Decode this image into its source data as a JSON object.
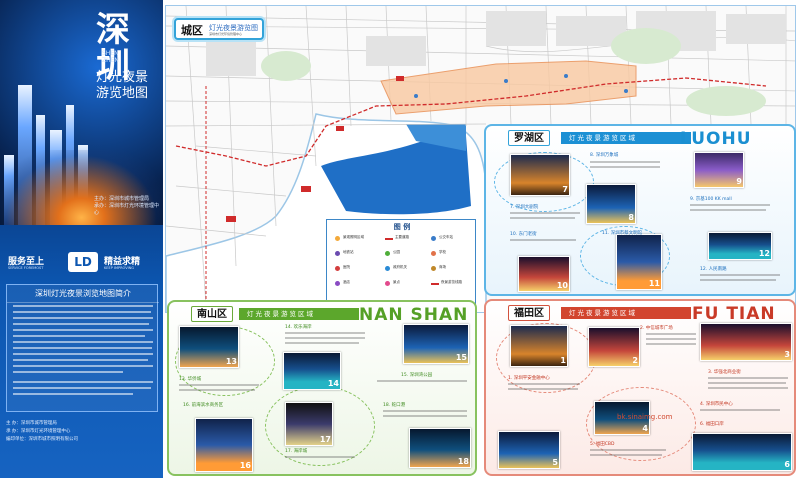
{
  "cover": {
    "title": "深圳",
    "title_en": "SHEN ZHEN",
    "subtitle1": "灯光夜景",
    "subtitle2": "游览地图",
    "org_lines": [
      "主办：深圳市城市管理局",
      "承办：深圳市灯光环境管理中心"
    ],
    "slogan_left": "服务至上",
    "slogan_right": "精益求精",
    "slogan_mid": "LD",
    "slogan_sub_left": "SERVICE FOREMOST",
    "slogan_sub_right": "KEEP IMPROVING",
    "intro_title": "深圳灯光夜景浏览地图简介",
    "credits": [
      "主 办：深圳市城市管理局",
      "承 办：深圳市灯光环境管理中心",
      "编印单位：深圳市城市照明有限公司"
    ]
  },
  "map": {
    "badge_zh": "城区",
    "badge_sub": "灯光夜景游览图",
    "badge_small": "深圳市灯光环境管理中心",
    "legend_title": "图 例",
    "legend_items": [
      {
        "label": "景观照明区域",
        "color": "#f3a93a"
      },
      {
        "label": "主要道路",
        "color": "#d02b2b"
      },
      {
        "label": "公交车站",
        "color": "#3a7cc9"
      },
      {
        "label": "地铁站",
        "color": "#6b4bb0"
      },
      {
        "label": "公园",
        "color": "#4fae3a"
      },
      {
        "label": "学校",
        "color": "#e1724a"
      },
      {
        "label": "医院",
        "color": "#d33d3d"
      },
      {
        "label": "政府机关",
        "color": "#2a8bd6"
      },
      {
        "label": "商场",
        "color": "#c0882a"
      },
      {
        "label": "酒店",
        "color": "#8a4bc3"
      },
      {
        "label": "景点",
        "color": "#e24a8c"
      },
      {
        "label": "夜景游览线路",
        "color": "#d02b2b"
      }
    ]
  },
  "districts": {
    "luohu": {
      "name": "罗湖区",
      "band": "灯光夜景游览区域",
      "en": "LUOHU",
      "captions": [
        "8. 深圳万象城",
        "7. 深圳大剧院",
        "9. 京基100 KK mall",
        "10. 东门老街",
        "11. 深圳市蔡文明馆",
        "12. 人民南路"
      ],
      "numbers": [
        "7",
        "8",
        "9",
        "10",
        "11",
        "12"
      ]
    },
    "nanshan": {
      "name": "南山区",
      "band": "灯光夜景游览区域",
      "en": "NAN SHAN",
      "captions": [
        "14. 欢乐海岸",
        "13. 华侨城",
        "15. 深圳湾公园",
        "16. 前海滨水商务区",
        "17. 海岸城",
        "18. 蛇口港"
      ],
      "numbers": [
        "13",
        "14",
        "15",
        "16",
        "17",
        "18"
      ]
    },
    "futian": {
      "name": "福田区",
      "band": "灯光夜景游览区域",
      "en": "FU TIAN",
      "captions": [
        "2. 中信城市广场",
        "1. 深圳平安金融中心",
        "3. 华强北商业街",
        "4. 深圳市民中心",
        "5. 福田CBD",
        "6. 福田口岸"
      ],
      "numbers": [
        "1",
        "2",
        "3",
        "4",
        "5",
        "6"
      ]
    }
  },
  "watermark": "bk.sinaimg.com"
}
